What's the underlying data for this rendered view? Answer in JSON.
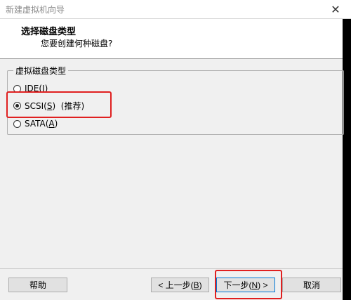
{
  "window": {
    "title": "新建虚拟机向导",
    "close_glyph": "✕"
  },
  "header": {
    "heading": "选择磁盘类型",
    "subheading": "您要创建何种磁盘?"
  },
  "disk_type": {
    "legend": "虚拟磁盘类型",
    "options": [
      {
        "prefix": "IDE(",
        "mnemonic": "I",
        "suffix": ")",
        "note": "",
        "checked": false
      },
      {
        "prefix": "SCSI(",
        "mnemonic": "S",
        "suffix": ")",
        "note": "  (推荐)",
        "checked": true
      },
      {
        "prefix": "SATA(",
        "mnemonic": "A",
        "suffix": ")",
        "note": "",
        "checked": false
      }
    ]
  },
  "buttons": {
    "help": "帮助",
    "back_prefix": "< 上一步(",
    "back_mnemonic": "B",
    "back_suffix": ")",
    "next_prefix": "下一步(",
    "next_mnemonic": "N",
    "next_suffix": ") >",
    "cancel": "取消"
  },
  "colors": {
    "highlight": "#e02020",
    "focus_border": "#0078d7"
  }
}
